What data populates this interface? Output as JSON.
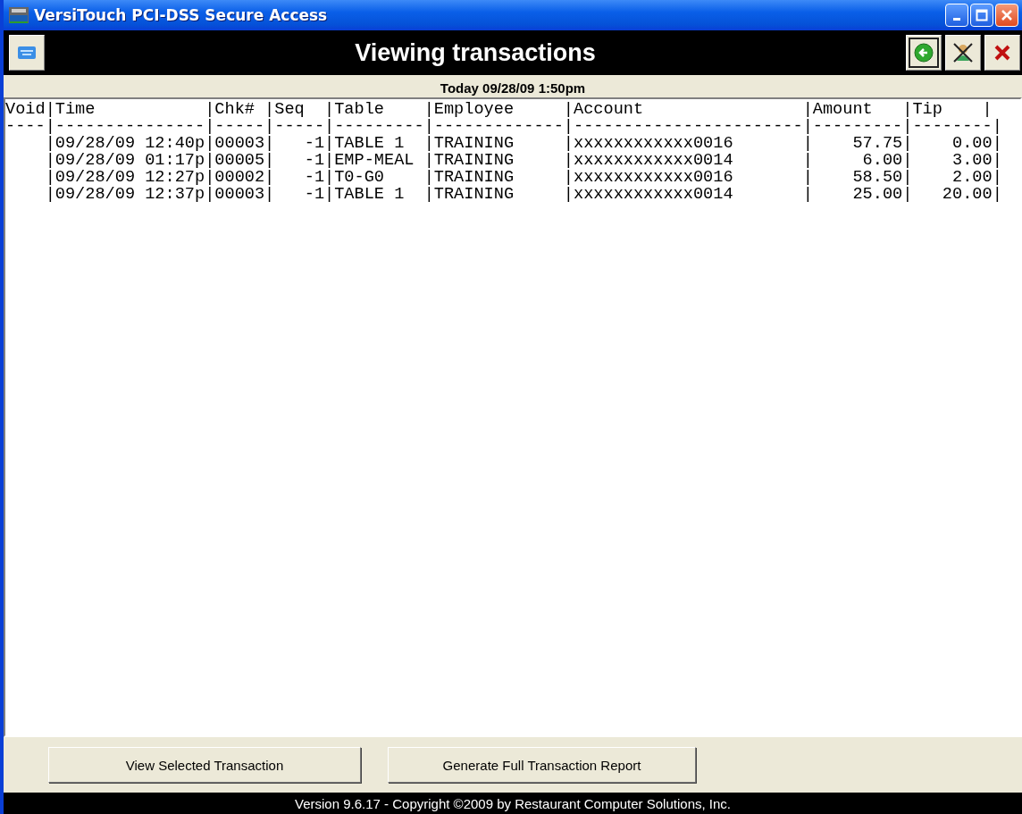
{
  "window": {
    "title": "VersiTouch PCI-DSS Secure Access"
  },
  "toolbar": {
    "title": "Viewing transactions"
  },
  "date_header": "Today 09/28/09 1:50pm",
  "listing": {
    "header": "Void|Time           |Chk# |Seq  |Table    |Employee     |Account                |Amount   |Tip    |",
    "separator": "----|---------------|-----|-----|---------|-------------|-----------------------|---------|--------|",
    "rows": [
      {
        "text": "    |09/28/09 12:40p|00003|   -1|TABLE 1  |TRAINING     |xxxxxxxxxxxx0016       |    57.75|    0.00|",
        "selected": false
      },
      {
        "text": "    |09/28/09 01:17p|00005|   -1|EMP-MEAL |TRAINING     |xxxxxxxxxxxx0014       |     6.00|    3.00|",
        "selected": false
      },
      {
        "text": "    |09/28/09 12:27p|00002|   -1|T0-G0    |TRAINING     |xxxxxxxxxxxx0016       |    58.50|    2.00|",
        "selected": false
      },
      {
        "text": "    |09/28/09 12:37p|00003|   -1|TABLE 1  |TRAINING     |xxxxxxxxxxxx0014       |    25.00|   20.00|",
        "selected": false
      }
    ]
  },
  "buttons": [
    "View Selected Transaction",
    "Generate Full Transaction Report"
  ],
  "footer": "Version 9.6.17 - Copyright ©2009 by Restaurant Computer Solutions, Inc."
}
